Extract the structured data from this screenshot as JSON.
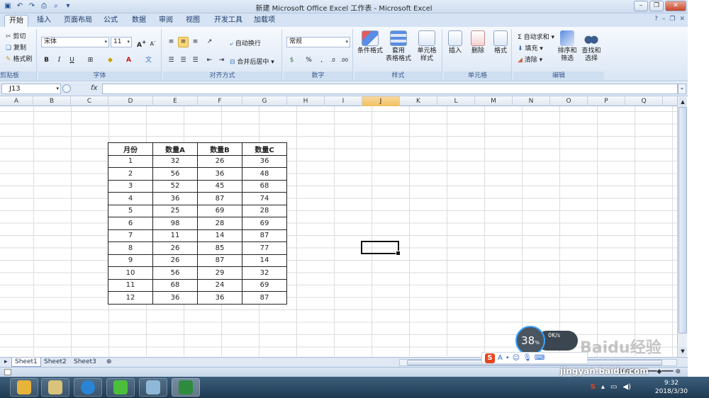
{
  "window": {
    "title": "新建 Microsoft Office Excel 工作表 - Microsoft Excel"
  },
  "tabs": [
    "开始",
    "插入",
    "页面布局",
    "公式",
    "数据",
    "审阅",
    "视图",
    "开发工具",
    "加载项"
  ],
  "ribbon": {
    "clipboard": {
      "cut": "剪切",
      "copy": "复制",
      "format_painter": "格式刷",
      "label": "剪贴板"
    },
    "font": {
      "name": "宋体",
      "size": "11",
      "label": "字体"
    },
    "alignment": {
      "wrap": "自动换行",
      "merge": "合并后居中",
      "label": "对齐方式"
    },
    "number": {
      "format": "常规",
      "label": "数字"
    },
    "styles": {
      "conditional": "条件格式",
      "table_l1": "套用",
      "table_l2": "表格格式",
      "cell_l1": "单元格",
      "cell_l2": "样式",
      "label": "样式"
    },
    "cells": {
      "insert": "插入",
      "delete": "删除",
      "format": "格式",
      "label": "单元格"
    },
    "editing": {
      "autosum": "自动求和",
      "fill": "填充",
      "clear": "清除",
      "sort_l1": "排序和",
      "sort_l2": "筛选",
      "find_l1": "查找和",
      "find_l2": "选择",
      "label": "编辑"
    }
  },
  "formula_bar": {
    "name_box": "J13",
    "fx": "fx",
    "value": ""
  },
  "columns": [
    "A",
    "B",
    "C",
    "D",
    "E",
    "F",
    "G",
    "H",
    "I",
    "J",
    "K",
    "L",
    "M",
    "N",
    "O",
    "P",
    "Q"
  ],
  "selected_column": "J",
  "table": {
    "headers": [
      "月份",
      "数量A",
      "数量B",
      "数量C"
    ],
    "rows": [
      [
        "1",
        "32",
        "26",
        "36"
      ],
      [
        "2",
        "56",
        "36",
        "48"
      ],
      [
        "3",
        "52",
        "45",
        "68"
      ],
      [
        "4",
        "36",
        "87",
        "74"
      ],
      [
        "5",
        "25",
        "69",
        "28"
      ],
      [
        "6",
        "98",
        "28",
        "69"
      ],
      [
        "7",
        "11",
        "14",
        "87"
      ],
      [
        "8",
        "26",
        "85",
        "77"
      ],
      [
        "9",
        "26",
        "87",
        "14"
      ],
      [
        "10",
        "56",
        "29",
        "32"
      ],
      [
        "11",
        "68",
        "24",
        "69"
      ],
      [
        "12",
        "36",
        "36",
        "87"
      ]
    ]
  },
  "sheets": [
    "Sheet1",
    "Sheet2",
    "Sheet3"
  ],
  "status": {
    "zoom": "100%"
  },
  "overlay": {
    "percent": "38",
    "percent_unit": "%",
    "speed": "0K/s"
  },
  "watermark": {
    "brand": "Baidu经验",
    "url": "jingyan.baidu.com"
  },
  "taskbar": {
    "time": "9:32",
    "date": "2018/3/30"
  }
}
